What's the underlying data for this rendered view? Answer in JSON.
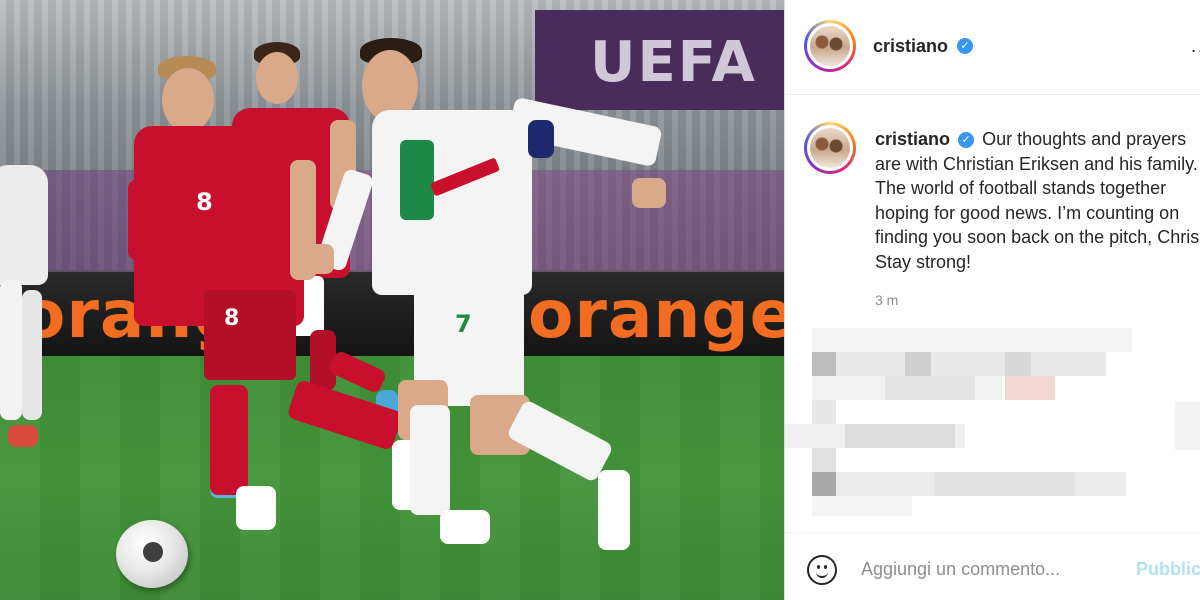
{
  "post": {
    "username": "cristiano",
    "caption_user": "cristiano",
    "caption_text": "Our thoughts and prayers are with Christian Eriksen and his family. The world of football stands together hoping for good news. I’m counting on finding you soon back on the pitch, Chris! Stay strong!",
    "time": "3 m",
    "verified_glyph": "✓",
    "more_glyph": "..."
  },
  "photo": {
    "board_text": "UEFA",
    "banner_text": "orange",
    "shirt_number_denmark": "8",
    "shirt_number_portugal": "7"
  },
  "comment_box": {
    "placeholder": "Aggiungi un commento...",
    "publish_label": "Pubblica"
  },
  "icons": {
    "verified": "verified-badge-icon",
    "more": "more-options-icon",
    "emoji": "emoji-icon"
  },
  "colors": {
    "verified_blue": "#3897f0",
    "publish_disabled": "#b2dffc",
    "denmark_red": "#c8102e",
    "portugal_white": "#f4f4f4",
    "banner_orange": "#f26d21"
  }
}
